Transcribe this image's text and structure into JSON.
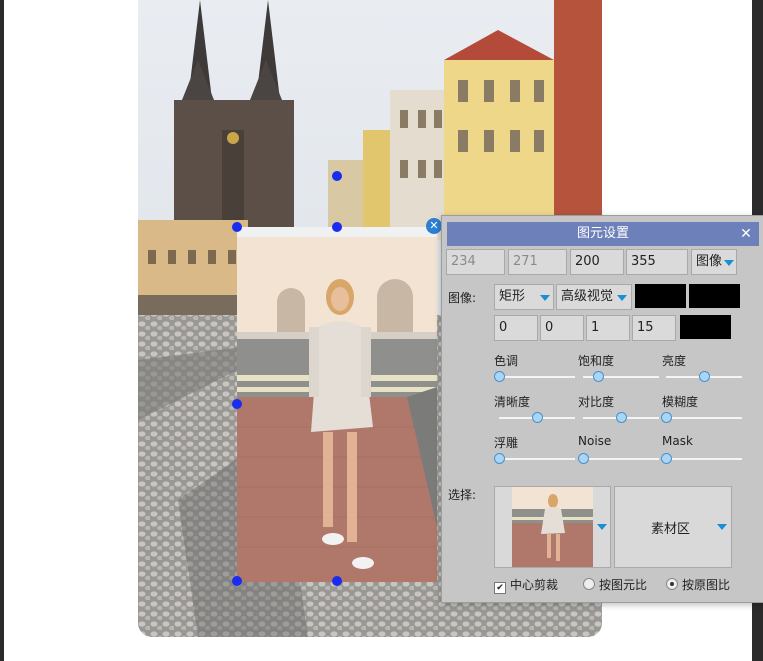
{
  "panel": {
    "title": "图元设置",
    "close_icon": "close-icon",
    "position": {
      "x": "234",
      "y": "271",
      "w": "200",
      "h": "355",
      "mode": "图像"
    },
    "image_label": "图像:",
    "shape": "矩形",
    "view": "高级视觉",
    "swatch_colors": [
      "#000000",
      "#000000",
      "#000000"
    ],
    "offsets": [
      "0",
      "0",
      "1",
      "15"
    ],
    "sliders": [
      {
        "label": "色调",
        "value": 0
      },
      {
        "label": "饱和度",
        "value": 0.2
      },
      {
        "label": "亮度",
        "value": 0.5
      },
      {
        "label": "清晰度",
        "value": 0.5
      },
      {
        "label": "对比度",
        "value": 0.5
      },
      {
        "label": "模糊度",
        "value": 0
      },
      {
        "label": "浮雕",
        "value": 0
      },
      {
        "label": "Noise",
        "value": 0
      },
      {
        "label": "Mask",
        "value": 0
      }
    ],
    "select_label": "选择:",
    "material": "素材区",
    "center_crop": "中心剪裁",
    "ratio_element": "按图元比",
    "ratio_original": "按原图比",
    "center_crop_checked": true,
    "selected_ratio": "按原图比"
  },
  "accent_colors": {
    "title_bar": "#6e80ba",
    "handle": "#1a2cf0",
    "arrow": "#1a8fd6"
  }
}
